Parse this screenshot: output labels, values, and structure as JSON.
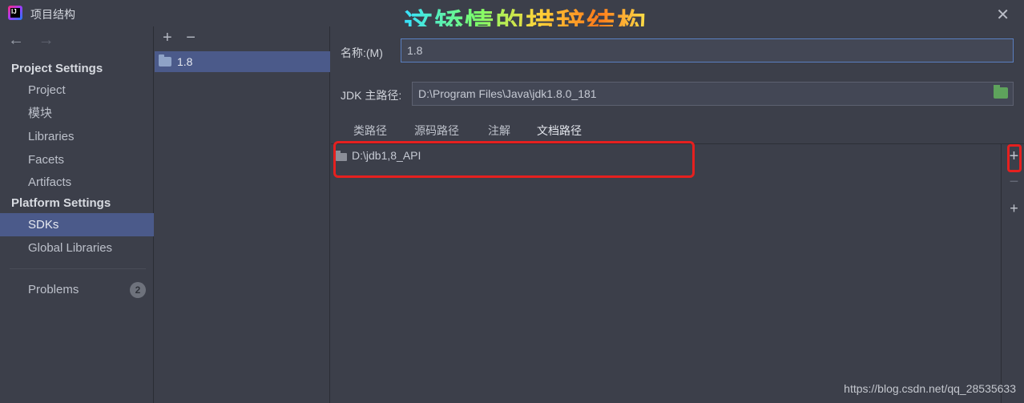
{
  "window": {
    "title": "项目结构",
    "overlay_title": "这矫情的措辞结构",
    "close_glyph": "✕"
  },
  "nav": {
    "back_glyph": "←",
    "forward_glyph": "→",
    "project_settings_header": "Project Settings",
    "project_items": [
      "Project",
      "模块",
      "Libraries",
      "Facets",
      "Artifacts"
    ],
    "platform_settings_header": "Platform Settings",
    "platform_items": [
      "SDKs",
      "Global Libraries"
    ],
    "selected": "SDKs",
    "problems_label": "Problems",
    "problems_count": "2"
  },
  "sdk_list": {
    "add_glyph": "+",
    "remove_glyph": "−",
    "items": [
      "1.8"
    ]
  },
  "detail": {
    "name_label": "名称:(M)",
    "name_value": "1.8",
    "jdk_label": "JDK 主路径:",
    "jdk_value": "D:\\Program Files\\Java\\jdk1.8.0_181",
    "tabs": [
      "类路径",
      "源码路径",
      "注解",
      "文档路径"
    ],
    "active_tab": "文档路径",
    "paths": [
      "D:\\jdb1,8_API"
    ]
  },
  "side_toolbar": {
    "add_glyph": "+",
    "remove_glyph": "−",
    "add_url_glyph": "+"
  },
  "footer": {
    "watermark": "https://blog.csdn.net/qq_28535633"
  },
  "colors": {
    "background": "#3c3f4a",
    "selection": "#4b5a8a",
    "highlight_box": "#e5201f",
    "active_tab_underline": "#c77dff"
  }
}
